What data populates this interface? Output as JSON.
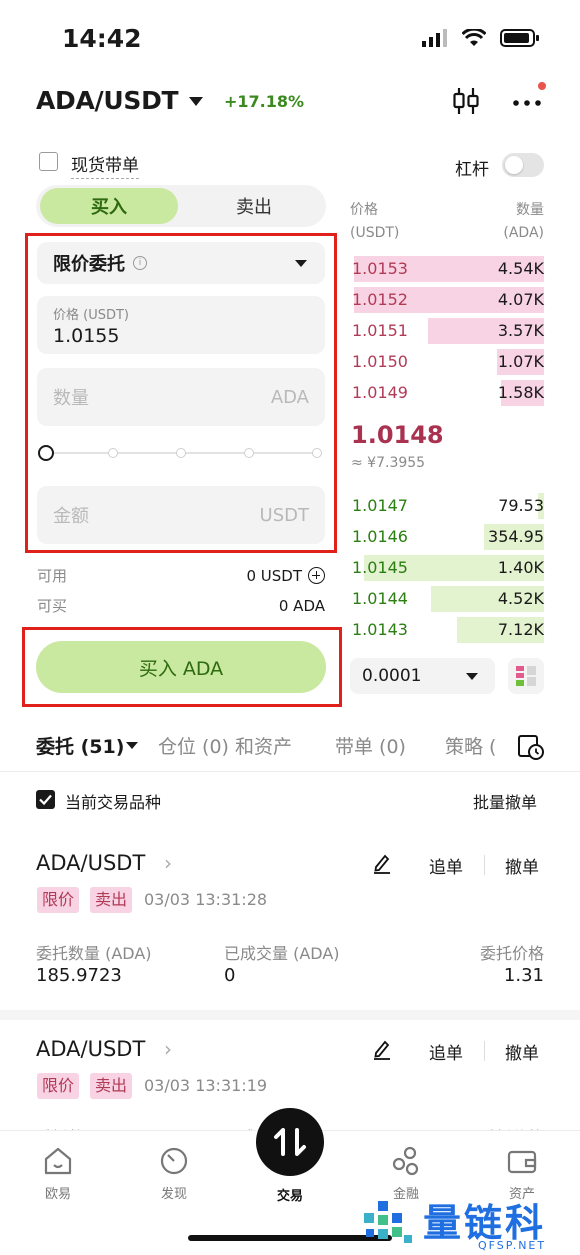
{
  "status_bar": {
    "time": "14:42"
  },
  "header": {
    "pair": "ADA/USDT",
    "change": "+17.18%"
  },
  "spot_with_order": {
    "label": "现货带单",
    "checked": false
  },
  "leverage": {
    "label": "杠杆",
    "on": false
  },
  "side_tabs": {
    "buy": "买入",
    "sell": "卖出",
    "active": "buy"
  },
  "form": {
    "order_type": "限价委托",
    "info_glyph": "i",
    "price_label": "价格 (USDT)",
    "price_value": "1.0155",
    "quantity_placeholder": "数量",
    "quantity_unit": "ADA",
    "slider_percent": 0,
    "amount_placeholder": "金额",
    "amount_unit": "USDT",
    "available_label": "可用",
    "available_value": "0 USDT",
    "buyable_label": "可买",
    "buyable_value": "0 ADA",
    "buy_button": "买入 ADA"
  },
  "orderbook": {
    "price_header": "价格",
    "price_unit": "(USDT)",
    "qty_header": "数量",
    "qty_unit": "(ADA)",
    "asks": [
      {
        "price": "1.0153",
        "qty": "4.54K",
        "depth": 0.98
      },
      {
        "price": "1.0152",
        "qty": "4.07K",
        "depth": 0.98
      },
      {
        "price": "1.0151",
        "qty": "3.57K",
        "depth": 0.6
      },
      {
        "price": "1.0150",
        "qty": "1.07K",
        "depth": 0.24
      },
      {
        "price": "1.0149",
        "qty": "1.58K",
        "depth": 0.22
      }
    ],
    "last_price": "1.0148",
    "last_price_cny": "≈ ¥7.3955",
    "bids": [
      {
        "price": "1.0147",
        "qty": "79.53",
        "depth": 0.03
      },
      {
        "price": "1.0146",
        "qty": "354.95",
        "depth": 0.31
      },
      {
        "price": "1.0145",
        "qty": "1.40K",
        "depth": 0.93
      },
      {
        "price": "1.0144",
        "qty": "4.52K",
        "depth": 0.58
      },
      {
        "price": "1.0143",
        "qty": "7.12K",
        "depth": 0.45
      }
    ],
    "precision": "0.0001"
  },
  "order_tabs": {
    "tabs": [
      "委托 (51)",
      "仓位 (0) 和资产",
      "带单 (0)",
      "策略 ("
    ],
    "active": 0
  },
  "filter": {
    "current_pair_label": "当前交易品种",
    "checked": true,
    "batch_cancel": "批量撤单"
  },
  "orders": [
    {
      "pair": "ADA/USDT",
      "tags": [
        "限价",
        "卖出"
      ],
      "time": "03/03 13:31:28",
      "follow": "追单",
      "cancel": "撤单",
      "qty_label": "委托数量 (ADA)",
      "qty": "185.9723",
      "filled_label": "已成交量 (ADA)",
      "filled": "0",
      "price_label": "委托价格",
      "price": "1.31"
    },
    {
      "pair": "ADA/USDT",
      "tags": [
        "限价",
        "卖出"
      ],
      "time": "03/03 13:31:19",
      "follow": "追单",
      "cancel": "撤单",
      "qty_label": "委托数量 (ADA)",
      "filled_label": "已成交量 (ADA)",
      "price_label": "委托价格"
    }
  ],
  "bottom_nav": {
    "items": [
      "欧易",
      "发现",
      "交易",
      "金融",
      "资产"
    ],
    "active": 2
  },
  "watermark": {
    "text": "量链科技",
    "sub": "QFSP.NET"
  },
  "colors": {
    "buy_green": "#c9e8a0",
    "buy_text": "#2f6a10",
    "ask_pink": "#f8d3e3",
    "ask_text": "#b13a57",
    "bid_green": "#e3f2cf",
    "bid_text": "#2b7e11",
    "highlight_red": "#e0201b"
  }
}
